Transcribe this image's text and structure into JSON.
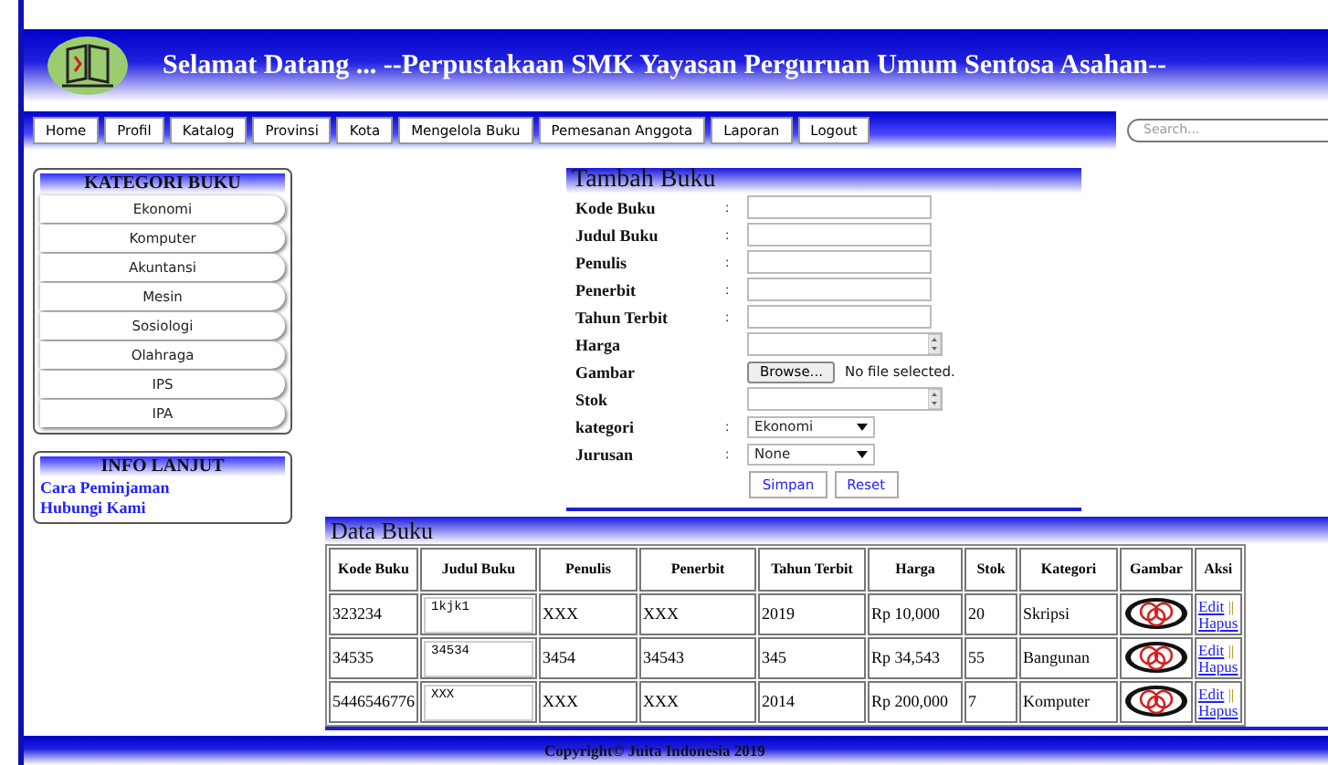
{
  "header": {
    "title": "Selamat Datang ... --Perpustakaan SMK Yayasan Perguruan Umum Sentosa Asahan--"
  },
  "nav": {
    "items": [
      {
        "label": "Home"
      },
      {
        "label": "Profil"
      },
      {
        "label": "Katalog"
      },
      {
        "label": "Provinsi"
      },
      {
        "label": "Kota"
      },
      {
        "label": "Mengelola Buku"
      },
      {
        "label": "Pemesanan Anggota"
      },
      {
        "label": "Laporan"
      },
      {
        "label": "Logout"
      }
    ],
    "search": {
      "placeholder": "Search..."
    }
  },
  "sidebar": {
    "categories": {
      "title": "KATEGORI BUKU",
      "items": [
        "Ekonomi",
        "Komputer",
        "Akuntansi",
        "Mesin",
        "Sosiologi",
        "Olahraga",
        "IPS",
        "IPA"
      ]
    },
    "info": {
      "title": "INFO LANJUT",
      "links": [
        "Cara Peminjaman",
        "Hubungi Kami"
      ]
    }
  },
  "form": {
    "title": "Tambah Buku",
    "fields": [
      {
        "label": "Kode Buku",
        "separator": ":",
        "kind": "text"
      },
      {
        "label": "Judul Buku",
        "separator": ":",
        "kind": "text"
      },
      {
        "label": "Penulis",
        "separator": ":",
        "kind": "text"
      },
      {
        "label": "Penerbit",
        "separator": ":",
        "kind": "text"
      },
      {
        "label": "Tahun Terbit",
        "separator": ":",
        "kind": "text"
      },
      {
        "label": "Harga",
        "kind": "number"
      },
      {
        "label": "Gambar",
        "kind": "file",
        "button": "Browse...",
        "status": "No file selected."
      },
      {
        "label": "Stok",
        "kind": "number"
      },
      {
        "label": "kategori",
        "separator": ":",
        "kind": "select",
        "value": "Ekonomi"
      },
      {
        "label": "Jurusan",
        "separator": ":",
        "kind": "select",
        "value": "None"
      }
    ],
    "buttons": [
      "Simpan",
      "Reset"
    ]
  },
  "table": {
    "title": "Data Buku",
    "columns": [
      "Kode Buku",
      "Judul Buku",
      "Penulis",
      "Penerbit",
      "Tahun Terbit",
      "Harga",
      "Stok",
      "Kategori",
      "Gambar",
      "Aksi"
    ],
    "rows": [
      {
        "kode": "323234",
        "judul": "1kjk1",
        "penulis": "XXX",
        "penerbit": "XXX",
        "tahun": "2019",
        "harga": "Rp 10,000",
        "stok": "20",
        "kategori": "Skripsi",
        "edit": "Edit",
        "sep": "||",
        "hapus": "Hapus"
      },
      {
        "kode": "34535",
        "judul": "34534",
        "penulis": "3454",
        "penerbit": "34543",
        "tahun": "345",
        "harga": "Rp 34,543",
        "stok": "55",
        "kategori": "Bangunan",
        "edit": "Edit",
        "sep": "||",
        "hapus": "Hapus"
      },
      {
        "kode": "5446546776",
        "judul": "XXX",
        "penulis": "XXX",
        "penerbit": "XXX",
        "tahun": "2014",
        "harga": "Rp 200,000",
        "stok": "7",
        "kategori": "Komputer",
        "edit": "Edit",
        "sep": "||",
        "hapus": "Hapus"
      }
    ]
  },
  "footer": {
    "text": "Copyright© Juita Indonesia 2019"
  }
}
